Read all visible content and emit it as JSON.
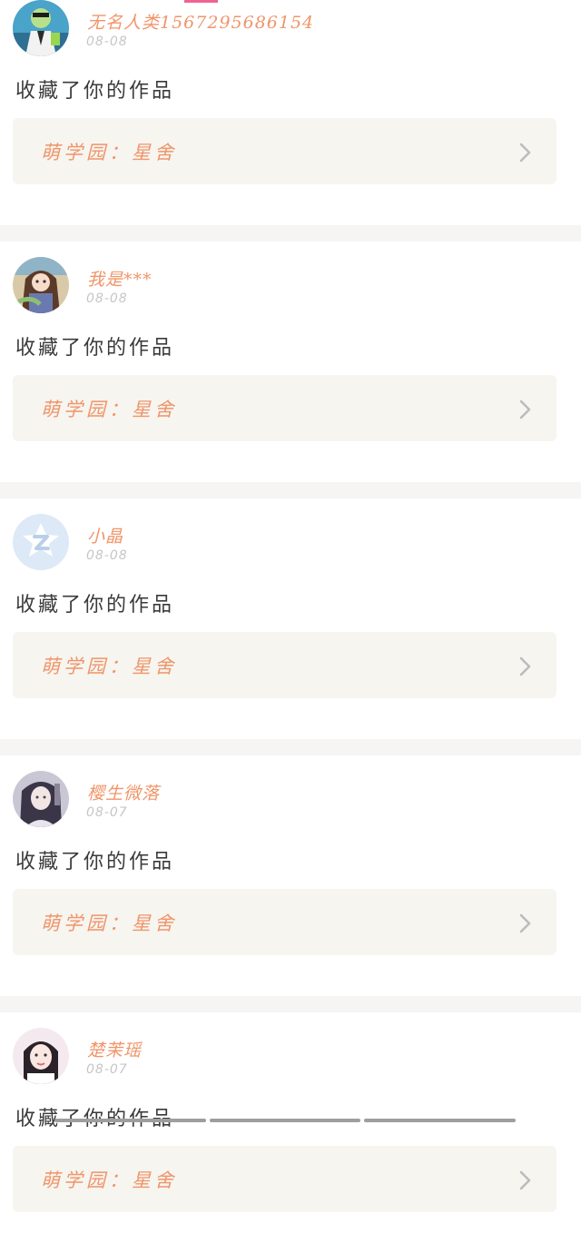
{
  "colors": {
    "accent": "#f0956a",
    "date": "#c6c6c6",
    "link_box_bg": "#f6f5f0",
    "divider_bg": "#f6f5f3",
    "tab_indicator": "#f06292"
  },
  "feed": {
    "items": [
      {
        "user": "无名人类15672956861​54",
        "date": "08-08",
        "action": "收藏了你的作品",
        "link_text": "萌学园：星舍",
        "avatar_icon": "avatar-green-figure-icon"
      },
      {
        "user": "我是***",
        "date": "08-08",
        "action": "收藏了你的作品",
        "link_text": "萌学园：星舍",
        "avatar_icon": "avatar-anime-girl-icon"
      },
      {
        "user": "小晶",
        "date": "08-08",
        "action": "收藏了你的作品",
        "link_text": "萌学园：星舍",
        "avatar_icon": "avatar-default-z-icon"
      },
      {
        "user": "樱生微落",
        "date": "08-07",
        "action": "收藏了你的作品",
        "link_text": "萌学园：星舍",
        "avatar_icon": "avatar-ancient-character-icon"
      },
      {
        "user": "楚茉瑶",
        "date": "08-07",
        "action": "收藏了你的作品",
        "link_text": "萌学园：星舍",
        "avatar_icon": "avatar-girl-photo-icon"
      }
    ]
  }
}
